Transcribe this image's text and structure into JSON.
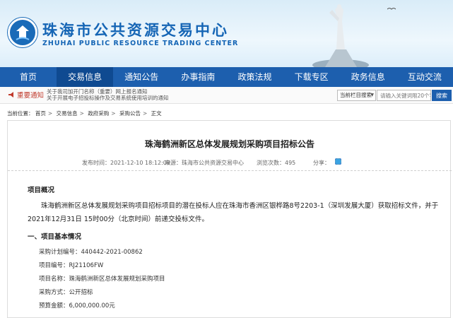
{
  "header": {
    "title": "珠海市公共资源交易中心",
    "subtitle": "ZHUHAI PUBLIC RESOURCE TRADING CENTER"
  },
  "nav": {
    "items": [
      "首页",
      "交易信息",
      "通知公告",
      "办事指南",
      "政策法规",
      "下载专区",
      "政务信息",
      "互动交流"
    ],
    "active_index": 1
  },
  "notice": {
    "label": "重要通知",
    "lines": [
      "关于我司加开门名称（重要）网上报名通知",
      "关于开展电子招投标操作及交易系统使用培训的通知"
    ]
  },
  "search": {
    "scope": "当前栏目搜索",
    "placeholder": "请输入关键词限20个字",
    "button": "搜索"
  },
  "breadcrumb": {
    "label": "当前位置：",
    "items": [
      "首页",
      "交易信息",
      "政府采购",
      "采购公告",
      "正文"
    ]
  },
  "article": {
    "title": "珠海鹤洲新区总体发展规划采购项目招标公告",
    "publish_time": "发布时间：2021-12-10 18:12:09",
    "source": "来源：珠海市公共资源交易中心",
    "views": "浏览次数：495",
    "share_label": "分享："
  },
  "content": {
    "overview_title": "项目概况",
    "overview_text": "珠海鹤洲新区总体发展规划采购项目招标项目的潜在投标人应在珠海市香洲区银桦路8号2203-1（深圳发展大厦）获取招标文件，并于2021年12月31日 15时00分（北京时间）前递交投标文件。",
    "basic_title": "一、项目基本情况",
    "fields": [
      "采购计划编号：440442-2021-00862",
      "项目编号：RJ21106FW",
      "项目名称：珠海鹤洲新区总体发展规划采购项目",
      "采购方式：公开招标",
      "预算金额：6,000,000.00元"
    ]
  },
  "colors": {
    "nav_bg": "#1d5fae",
    "brand": "#1565b5",
    "notice_red": "#c0392b"
  }
}
